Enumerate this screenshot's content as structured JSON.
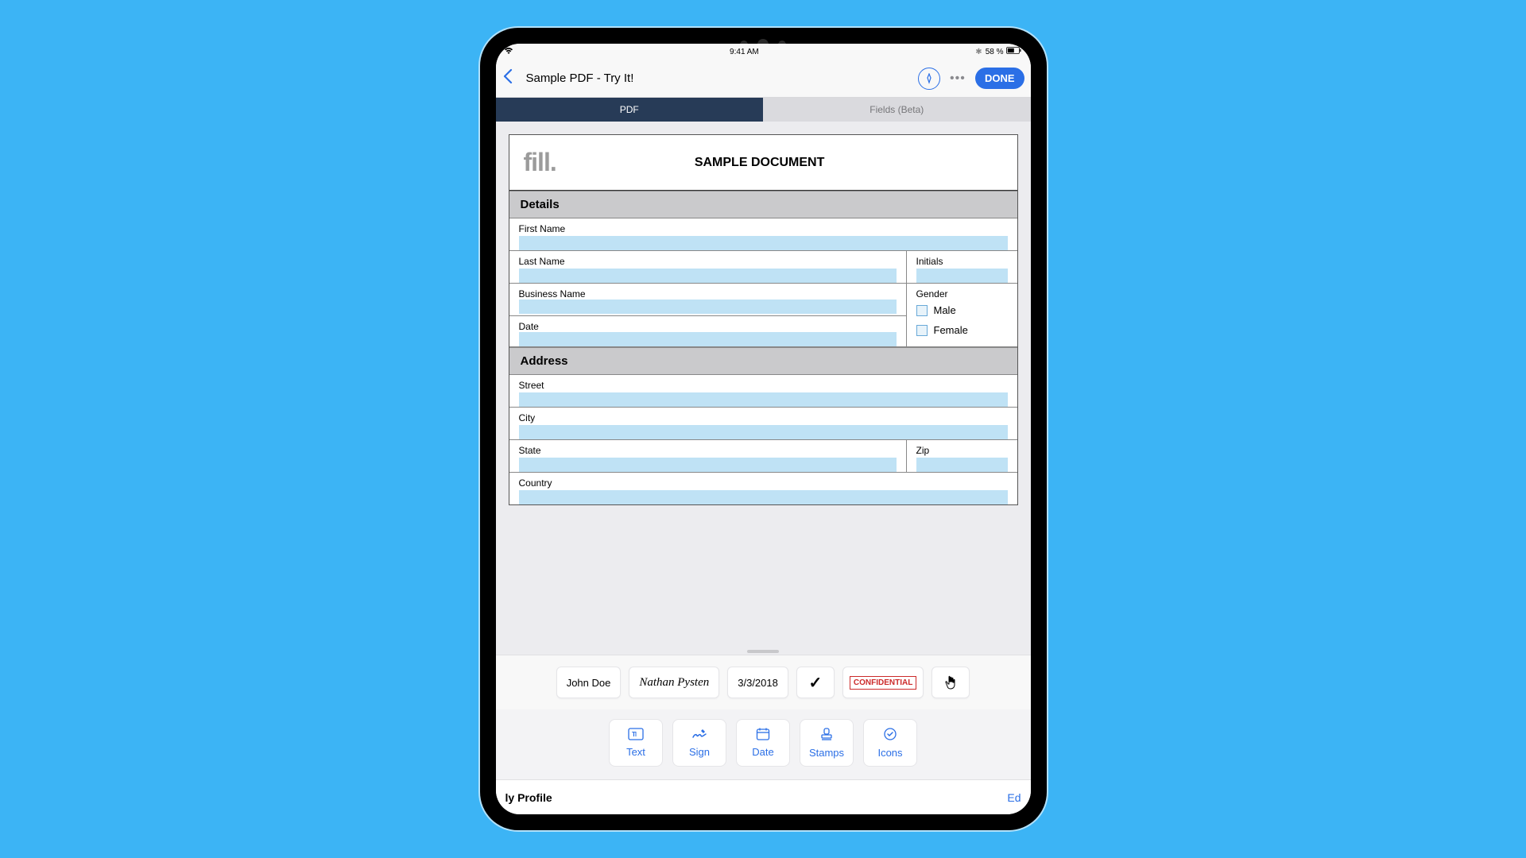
{
  "status": {
    "time": "9:41 AM",
    "battery": "58 %"
  },
  "nav": {
    "title": "Sample PDF - Try It!",
    "done": "DONE"
  },
  "tabs": {
    "pdf": "PDF",
    "fields": "Fields (Beta)"
  },
  "doc": {
    "logo": "fill.",
    "title": "SAMPLE DOCUMENT",
    "sections": {
      "details": "Details",
      "address": "Address"
    },
    "labels": {
      "firstName": "First Name",
      "lastName": "Last Name",
      "initials": "Initials",
      "businessName": "Business Name",
      "gender": "Gender",
      "male": "Male",
      "female": "Female",
      "date": "Date",
      "street": "Street",
      "city": "City",
      "state": "State",
      "zip": "Zip",
      "country": "Country"
    }
  },
  "quick": {
    "name": "John Doe",
    "signature": "Nathan Pysten",
    "date": "3/3/2018",
    "stamp": "CONFIDENTIAL"
  },
  "tools": {
    "text": "Text",
    "sign": "Sign",
    "date": "Date",
    "stamps": "Stamps",
    "icons": "Icons"
  },
  "profile": {
    "label": "ly Profile",
    "edit": "Ed"
  }
}
